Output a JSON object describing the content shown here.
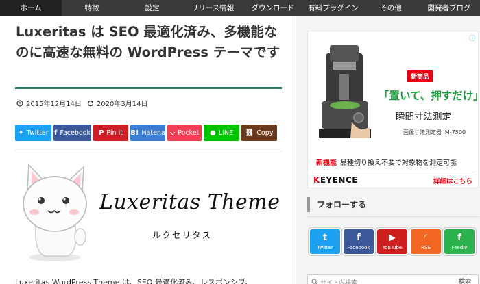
{
  "nav": {
    "items": [
      {
        "label": "ホーム",
        "active": true
      },
      {
        "label": "特徴"
      },
      {
        "label": "設定"
      },
      {
        "label": "リリース情報"
      },
      {
        "label": "ダウンロード"
      },
      {
        "label": "有料プラグイン"
      },
      {
        "label": "その他"
      },
      {
        "label": "開発者ブログ"
      }
    ]
  },
  "article": {
    "title": "Luxeritas は SEO 最適化済み、多機能なのに高速な無料の WordPress テーマです",
    "published": "2015年12月14日",
    "updated": "2020年3月14日",
    "share": [
      {
        "label": "Twitter",
        "icon": "twitter-icon",
        "color": "#1da1f2"
      },
      {
        "label": "Facebook",
        "icon": "facebook-icon",
        "color": "#3b5998"
      },
      {
        "label": "Pin it",
        "icon": "pinterest-icon",
        "color": "#cb2027"
      },
      {
        "label": "Hatena",
        "icon": "hatena-icon",
        "color": "#3c7dd1"
      },
      {
        "label": "Pocket",
        "icon": "pocket-icon",
        "color": "#ef4056"
      },
      {
        "label": "LINE",
        "icon": "line-icon",
        "color": "#00c300"
      },
      {
        "label": "Copy",
        "icon": "link-icon",
        "color": "#6b3a1c"
      }
    ],
    "hero_title": "Luxeritas Theme",
    "hero_kana": "ルクセリタス",
    "intro": "Luxeritas WordPress Theme は、SEO 最適化済み、レスポンシブ、"
  },
  "sidebar": {
    "ad": {
      "badge": "新商品",
      "headline": "「置いて、押すだけ」",
      "subline": "瞬間寸法測定",
      "model": "画像寸法測定器 IM-7500",
      "feature_tag": "新機能",
      "feature": "品種切り換え不要で対象物を測定可能",
      "brand_k": "K",
      "brand_rest": "EYENCE",
      "more": "詳細はこちら"
    },
    "follow_title": "フォローする",
    "follow": [
      {
        "label": "Twitter",
        "glyph": "t",
        "color": "#1da1f2"
      },
      {
        "label": "Facebook",
        "glyph": "f",
        "color": "#3b5998"
      },
      {
        "label": "YouTube",
        "glyph": "▶",
        "color": "#cd201f"
      },
      {
        "label": "RSS",
        "glyph": "◜",
        "color": "#f26522"
      },
      {
        "label": "Feedly",
        "glyph": "f",
        "color": "#2bb24c"
      }
    ],
    "search": {
      "placeholder": "サイト内検索",
      "button": "検索"
    }
  }
}
